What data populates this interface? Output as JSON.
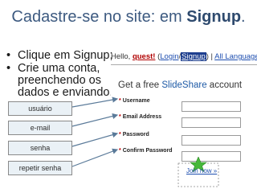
{
  "slide": {
    "title_prefix": "Cadastre-se no site: em ",
    "title_bold": "Signup",
    "title_suffix": ".",
    "bullets": [
      {
        "bullet": "•",
        "text": "Clique em Signup;"
      },
      {
        "bullet": "•",
        "text": "Crie uma conta, preenchendo os dados e enviando."
      }
    ],
    "labels": [
      "usuário",
      "e-mail",
      "senha",
      "repetir senha"
    ]
  },
  "site": {
    "greeting": "Hello, ",
    "user": "quest!",
    "open_paren": " (",
    "login": "Login",
    "separator": "/",
    "signup": "Signup",
    "close_paren": ")",
    "pipe": " | ",
    "language": "All Language"
  },
  "form": {
    "title_prefix": "Get a free ",
    "brand": "SlideShare",
    "title_suffix": " account",
    "required_mark": "*",
    "fields": [
      "Username",
      "Email Address",
      "Password",
      "Confirm Password"
    ],
    "join_label": "Join now »"
  },
  "colors": {
    "arrow": "#5a7a99",
    "highlight_star": "#46b83a",
    "title": "#3d5a80"
  }
}
